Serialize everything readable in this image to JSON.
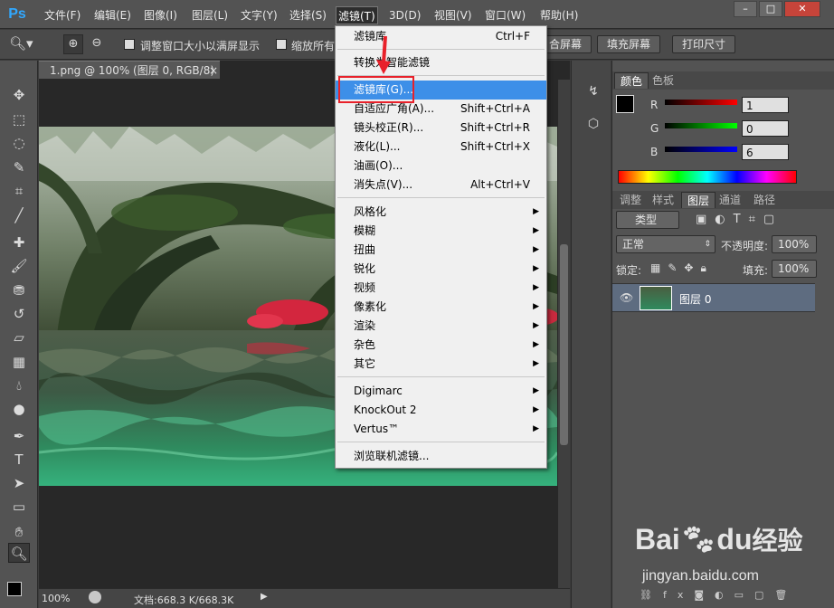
{
  "menubar": {
    "logo": "Ps",
    "items": [
      "文件(F)",
      "编辑(E)",
      "图像(I)",
      "图层(L)",
      "文字(Y)",
      "选择(S)",
      "滤镜(T)",
      "3D(D)",
      "视图(V)",
      "窗口(W)",
      "帮助(H)"
    ],
    "window_buttons": [
      "–",
      "□",
      "✕"
    ]
  },
  "options": {
    "checkbox1_label": "调整窗口大小以满屏显示",
    "checkbox2_label": "缩放所有",
    "btn_fit": "合屏幕",
    "btn_fill": "填充屏幕",
    "btn_print": "打印尺寸"
  },
  "document": {
    "tab_title": "1.png @ 100% (图层 0, RGB/8)",
    "tab_close": "×",
    "zoom": "100%",
    "doc_info": "文档:668.3 K/668.3K"
  },
  "filter_menu": {
    "items": [
      {
        "label": "滤镜库",
        "shortcut": "Ctrl+F"
      },
      {
        "label": "转换为智能滤镜",
        "shortcut": ""
      },
      {
        "label": "滤镜库(G)...",
        "shortcut": ""
      },
      {
        "label": "自适应广角(A)...",
        "shortcut": "Shift+Ctrl+A"
      },
      {
        "label": "镜头校正(R)...",
        "shortcut": "Shift+Ctrl+R"
      },
      {
        "label": "液化(L)...",
        "shortcut": "Shift+Ctrl+X"
      },
      {
        "label": "油画(O)...",
        "shortcut": ""
      },
      {
        "label": "消失点(V)...",
        "shortcut": "Alt+Ctrl+V"
      },
      {
        "label": "风格化",
        "shortcut": ""
      },
      {
        "label": "模糊",
        "shortcut": ""
      },
      {
        "label": "扭曲",
        "shortcut": ""
      },
      {
        "label": "锐化",
        "shortcut": ""
      },
      {
        "label": "视频",
        "shortcut": ""
      },
      {
        "label": "像素化",
        "shortcut": ""
      },
      {
        "label": "渲染",
        "shortcut": ""
      },
      {
        "label": "杂色",
        "shortcut": ""
      },
      {
        "label": "其它",
        "shortcut": ""
      },
      {
        "label": "Digimarc",
        "shortcut": ""
      },
      {
        "label": "KnockOut 2",
        "shortcut": ""
      },
      {
        "label": "Vertus™",
        "shortcut": ""
      },
      {
        "label": "浏览联机滤镜...",
        "shortcut": ""
      }
    ]
  },
  "color_panel": {
    "tabs": [
      "颜色",
      "色板"
    ],
    "r_label": "R",
    "r_value": "1",
    "g_label": "G",
    "g_value": "0",
    "b_label": "B",
    "b_value": "6"
  },
  "layers_panel": {
    "tabs": [
      "调整",
      "样式",
      "图层",
      "通道",
      "路径"
    ],
    "filter_kind": "类型",
    "blend_mode": "正常",
    "opacity_label": "不透明度:",
    "opacity_value": "100%",
    "lock_label": "锁定:",
    "fill_label": "填充:",
    "fill_value": "100%",
    "layer_name": "图层 0"
  },
  "watermark": {
    "brand": "Bai",
    "brand2": "du",
    "brand3": "经验",
    "url": "jingyan.baidu.com"
  },
  "colors": {
    "highlight": "#3d8fe8",
    "annotation_red": "#e8212a"
  }
}
